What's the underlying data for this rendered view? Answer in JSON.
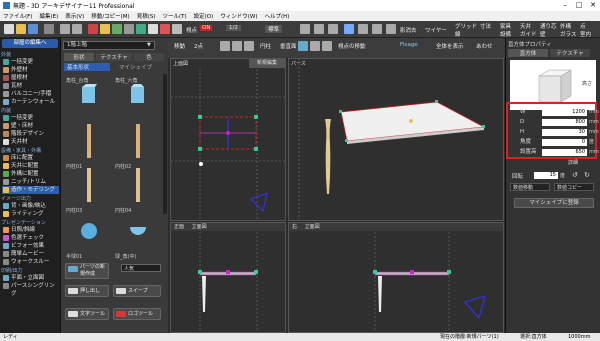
{
  "window": {
    "title": "無題 - 3D アーキデザイナー11 Professional"
  },
  "menu": [
    "ファイル(F)",
    "編集(E)",
    "表示(V)",
    "移動/コピー(M)",
    "見積(S)",
    "ツール(T)",
    "設定(O)",
    "ウィンドウ(W)",
    "ヘルプ(H)"
  ],
  "toolbar": {
    "mode_label": "視点",
    "mode_value": "ON",
    "scale_label": "1/2",
    "layout_label": "標準",
    "right_labels": [
      "グリッド",
      "線",
      "寸法",
      "家具",
      "設備",
      "天井",
      "ガイド",
      "通り芯",
      "壁",
      "外構",
      "ガラス",
      "点",
      "室内"
    ],
    "shadow_label": "影消去",
    "wireframe_label": "ワイヤー"
  },
  "left": {
    "back_label": "部屋の編集へ",
    "categories": [
      {
        "title": "外装",
        "items": [
          "一括変更",
          "外壁材",
          "屋根材",
          "瓦材",
          "バルコニー/手摺",
          "カーテンウォール"
        ]
      },
      {
        "title": "内装",
        "items": [
          "一括変更",
          "壁・床材",
          "階段デザイン",
          "天井材"
        ]
      },
      {
        "title": "設備・家具・外構",
        "items": [
          "床に配置",
          "天井に配置",
          "外構に配置",
          "ニッチ/トリム",
          "造作・モデリング"
        ]
      },
      {
        "title": "イメージ出力",
        "items": [
          "背・画像/映込",
          "ライティング"
        ]
      },
      {
        "title": "プレゼンテーション",
        "items": [
          "日照/斜線",
          "色選チェック",
          "ビフォー効果",
          "簡単ムービー",
          "ウォークスルー"
        ]
      },
      {
        "title": "印刷/出力",
        "items": [
          "平面・立面図",
          "パースシングリング"
        ]
      }
    ],
    "active": "造作・モデリング"
  },
  "parts": {
    "floor_select": "1階上階",
    "tabs": [
      "形状",
      "テクスチャ",
      "色"
    ],
    "section_label": "基本形状",
    "section_right": "マイシェイプ",
    "thumbs": [
      {
        "top": "角柱_台角",
        "bottom": ""
      },
      {
        "top": "角柱_六角",
        "bottom": ""
      },
      {
        "top": "",
        "bottom": "円柱01"
      },
      {
        "top": "",
        "bottom": "円柱02"
      },
      {
        "top": "",
        "bottom": "円柱03"
      },
      {
        "top": "",
        "bottom": "円柱04"
      },
      {
        "top": "",
        "bottom": "円柱05"
      },
      {
        "top": "",
        "bottom": "半球(中)"
      },
      {
        "top": "",
        "bottom": "半球01"
      },
      {
        "top": "",
        "bottom": "球_角(中)"
      }
    ],
    "buttons": [
      "パーツの新規作成",
      "押し出し",
      "スイープ",
      "文字ツール",
      "ロゴツール"
    ],
    "unit_label": "人気"
  },
  "viewport": {
    "tools": [
      "移動",
      "2点",
      "円柱",
      "垂直面",
      "視点の移動",
      "Fixage",
      "全体を表示",
      "あわせ"
    ],
    "top_label": "上面図",
    "top_button": "新規編集",
    "persp_label": "パース",
    "front_label": "正面",
    "front_view": "立面図",
    "side_label": "右",
    "side_view": "立面図"
  },
  "props": {
    "title": "直方体プロパティ",
    "tabs": [
      "直方体",
      "テクスチャ"
    ],
    "height_caption": "高さ",
    "rows": [
      {
        "label": "W",
        "value": "1200",
        "unit": "mm"
      },
      {
        "label": "D",
        "value": "800",
        "unit": "mm"
      },
      {
        "label": "H",
        "value": "30",
        "unit": "mm"
      },
      {
        "label": "角度",
        "value": "0",
        "unit": "度"
      },
      {
        "label": "設置高",
        "value": "650",
        "unit": "mm"
      }
    ],
    "detail_label": "詳細",
    "rotate_label": "回転",
    "rotate_value": "15",
    "rotate_unit": "度",
    "move_label": "数値移動",
    "copy_label": "数値コピー",
    "register_label": "マイシェイプに登録"
  },
  "status": {
    "left": "レディ",
    "right": "現在の階層:新規パーツ(1)",
    "mid": "選択:直方体",
    "scale": "1000mm"
  },
  "colors": {
    "accent": "#2c5fb0",
    "highlight": "#e02020"
  }
}
